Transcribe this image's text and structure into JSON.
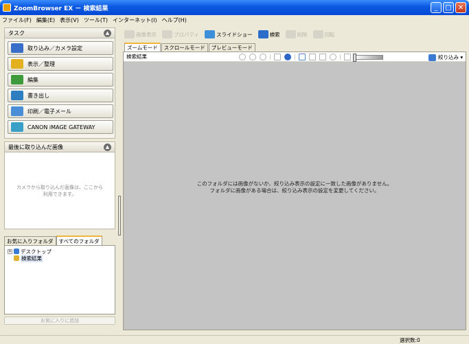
{
  "window": {
    "title": "ZoomBrowser EX － 検索結果"
  },
  "menu": [
    "ファイル(F)",
    "編集(E)",
    "表示(V)",
    "ツール(T)",
    "インターネット(I)",
    "ヘルプ(H)"
  ],
  "tasks": {
    "header": "タスク",
    "items": [
      {
        "label": "取り込み／カメラ設定",
        "icon": "camera-import-icon",
        "color": "#3a6fc9"
      },
      {
        "label": "表示／整理",
        "icon": "organize-icon",
        "color": "#e3b020"
      },
      {
        "label": "編集",
        "icon": "edit-icon",
        "color": "#3f9a3c"
      },
      {
        "label": "書き出し",
        "icon": "export-icon",
        "color": "#2f7fc0"
      },
      {
        "label": "印刷／電子メール",
        "icon": "print-icon",
        "color": "#4a8ed8"
      },
      {
        "label": "CANON iMAGE GATEWAY",
        "icon": "gateway-icon",
        "color": "#3aa0c8"
      }
    ]
  },
  "recent": {
    "header": "最後に取り込んだ画像",
    "message": "カメラから取り込んだ画像は、ここから\n利用できます。"
  },
  "folders": {
    "tabs": [
      "お気に入りフォルダ",
      "すべてのフォルダ"
    ],
    "tree": [
      {
        "label": "デスクトップ",
        "expander": "+"
      },
      {
        "label": "検索結果",
        "expander": ""
      }
    ],
    "add_favorite": "お気に入りに追加"
  },
  "toolbar": {
    "items": [
      {
        "label": "画像表示",
        "enabled": false
      },
      {
        "label": "プロパティ",
        "enabled": false
      },
      {
        "label": "スライドショー",
        "enabled": true
      },
      {
        "label": "検索",
        "enabled": true
      },
      {
        "label": "削除",
        "enabled": false
      },
      {
        "label": "回転",
        "enabled": false
      }
    ]
  },
  "view": {
    "tabs": [
      "ズームモード",
      "スクロールモード",
      "プレビューモード"
    ],
    "folder_label": "検索結果",
    "filter_label": "絞り込み ▾",
    "empty_message": "このフォルダには画像がないか、絞り込み表示の設定に一致した画像がありません。\nフォルダに画像がある場合は、絞り込み表示の設定を変更してください。"
  },
  "status": {
    "selected": "選択数:0"
  }
}
